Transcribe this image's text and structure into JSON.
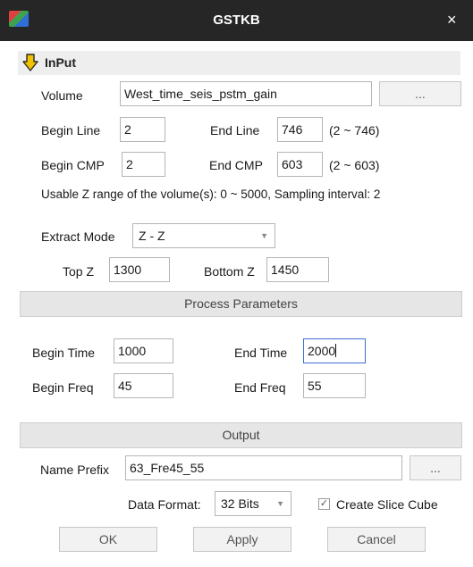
{
  "window": {
    "title": "GSTKB",
    "close_glyph": "×"
  },
  "input_section": {
    "title": "InPut",
    "volume_label": "Volume",
    "volume_value": "West_time_seis_pstm_gain",
    "browse_label": "...",
    "begin_line_label": "Begin Line",
    "begin_line_value": "2",
    "end_line_label": "End Line",
    "end_line_value": "746",
    "line_range": "(2 ~ 746)",
    "begin_cmp_label": "Begin CMP",
    "begin_cmp_value": "2",
    "end_cmp_label": "End CMP",
    "end_cmp_value": "603",
    "cmp_range": "(2 ~ 603)",
    "z_info": "Usable Z range of the volume(s): 0 ~ 5000, Sampling interval: 2",
    "extract_mode_label": "Extract Mode",
    "extract_mode_value": "Z - Z",
    "top_z_label": "Top Z",
    "top_z_value": "1300",
    "bottom_z_label": "Bottom Z",
    "bottom_z_value": "1450"
  },
  "process": {
    "title": "Process Parameters",
    "begin_time_label": "Begin Time",
    "begin_time_value": "1000",
    "end_time_label": "End Time",
    "end_time_value": "2000",
    "begin_freq_label": "Begin Freq",
    "begin_freq_value": "45",
    "end_freq_label": "End Freq",
    "end_freq_value": "55"
  },
  "output": {
    "title": "Output",
    "name_prefix_label": "Name Prefix",
    "name_prefix_value": "63_Fre45_55",
    "browse_label": "...",
    "data_format_label": "Data Format:",
    "data_format_value": "32 Bits",
    "create_slice_label": "Create Slice Cube",
    "create_slice_checked": true
  },
  "buttons": {
    "ok": "OK",
    "apply": "Apply",
    "cancel": "Cancel"
  },
  "icons": {
    "app": "app-icon",
    "close": "close-icon",
    "input_header": "down-arrow-icon",
    "combo": "chevron-down-icon",
    "checkbox": "checkmark-icon"
  },
  "colors": {
    "titlebar": "#262626",
    "section_header": "#eeeeee",
    "group_bar": "#e6e6e6",
    "arrow_fill": "#f2c200",
    "focus_border": "#3b6fd1"
  }
}
